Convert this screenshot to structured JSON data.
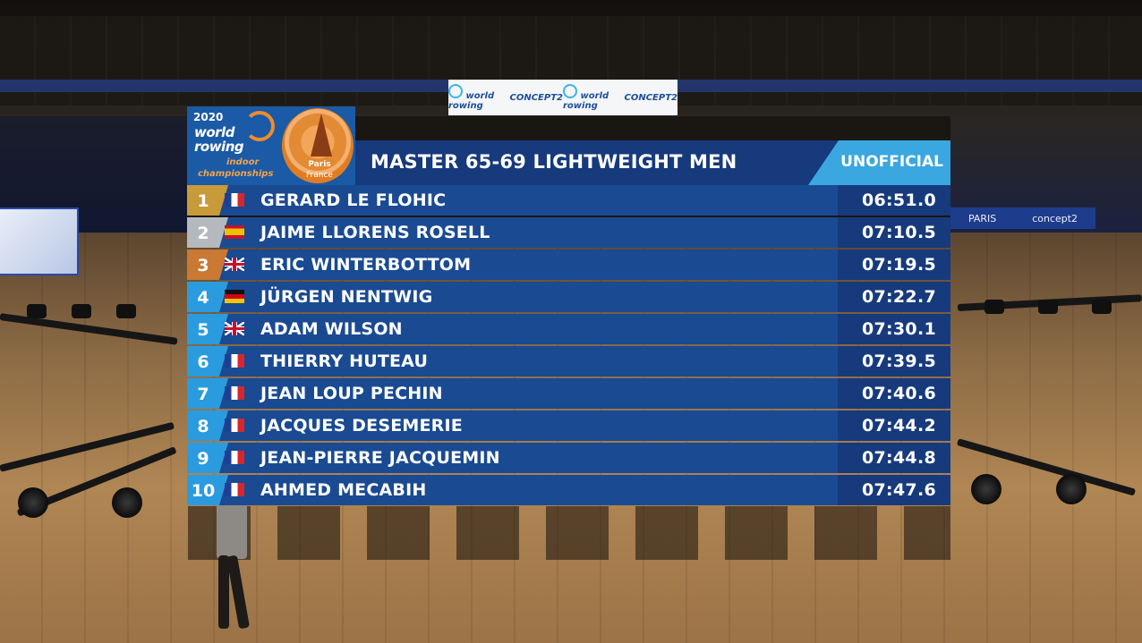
{
  "logo": {
    "year": "2020",
    "brand_line1": "world",
    "brand_line2": "rowing",
    "sub_line1": "indoor",
    "sub_line2": "championships",
    "city": "Paris",
    "country": "France"
  },
  "sponsor_board": {
    "items": [
      "world rowing",
      "CONCEPT2",
      "world rowing",
      "CONCEPT2"
    ]
  },
  "arena_banner": {
    "left_text": "PARIS",
    "right_text": "concept2"
  },
  "event": {
    "title": "MASTER 65-69 LIGHTWEIGHT MEN",
    "status": "UNOFFICIAL"
  },
  "results": [
    {
      "rank": "1",
      "country": "FRA",
      "flag_icon": "france-flag-icon",
      "name": "GERARD LE FLOHIC",
      "time": "06:51.0",
      "medal": "gold"
    },
    {
      "rank": "2",
      "country": "ESP",
      "flag_icon": "spain-flag-icon",
      "name": "JAIME LLORENS ROSELL",
      "time": "07:10.5",
      "medal": "silver"
    },
    {
      "rank": "3",
      "country": "GBR",
      "flag_icon": "uk-flag-icon",
      "name": "ERIC WINTERBOTTOM",
      "time": "07:19.5",
      "medal": "bronze"
    },
    {
      "rank": "4",
      "country": "GER",
      "flag_icon": "germany-flag-icon",
      "name": "JÜRGEN NENTWIG",
      "time": "07:22.7",
      "medal": "none"
    },
    {
      "rank": "5",
      "country": "GBR",
      "flag_icon": "uk-flag-icon",
      "name": "ADAM WILSON",
      "time": "07:30.1",
      "medal": "none"
    },
    {
      "rank": "6",
      "country": "FRA",
      "flag_icon": "france-flag-icon",
      "name": "THIERRY HUTEAU",
      "time": "07:39.5",
      "medal": "none"
    },
    {
      "rank": "7",
      "country": "FRA",
      "flag_icon": "france-flag-icon",
      "name": "JEAN LOUP PECHIN",
      "time": "07:40.6",
      "medal": "none"
    },
    {
      "rank": "8",
      "country": "FRA",
      "flag_icon": "france-flag-icon",
      "name": "JACQUES DESEMERIE",
      "time": "07:44.2",
      "medal": "none"
    },
    {
      "rank": "9",
      "country": "FRA",
      "flag_icon": "france-flag-icon",
      "name": "JEAN-PIERRE JACQUEMIN",
      "time": "07:44.8",
      "medal": "none"
    },
    {
      "rank": "10",
      "country": "FRA",
      "flag_icon": "france-flag-icon",
      "name": "AHMED MECABIH",
      "time": "07:47.6",
      "medal": "none"
    }
  ],
  "colors": {
    "title_bar": "#173a7d",
    "row": "#1a4a92",
    "rank_default": "#2b9be0",
    "gold": "#c99a3a",
    "silver": "#b5b8bd",
    "bronze": "#c97933",
    "unofficial": "#3aa7e0",
    "logo_blue": "#1a5aa6",
    "logo_orange": "#f08c2c"
  }
}
